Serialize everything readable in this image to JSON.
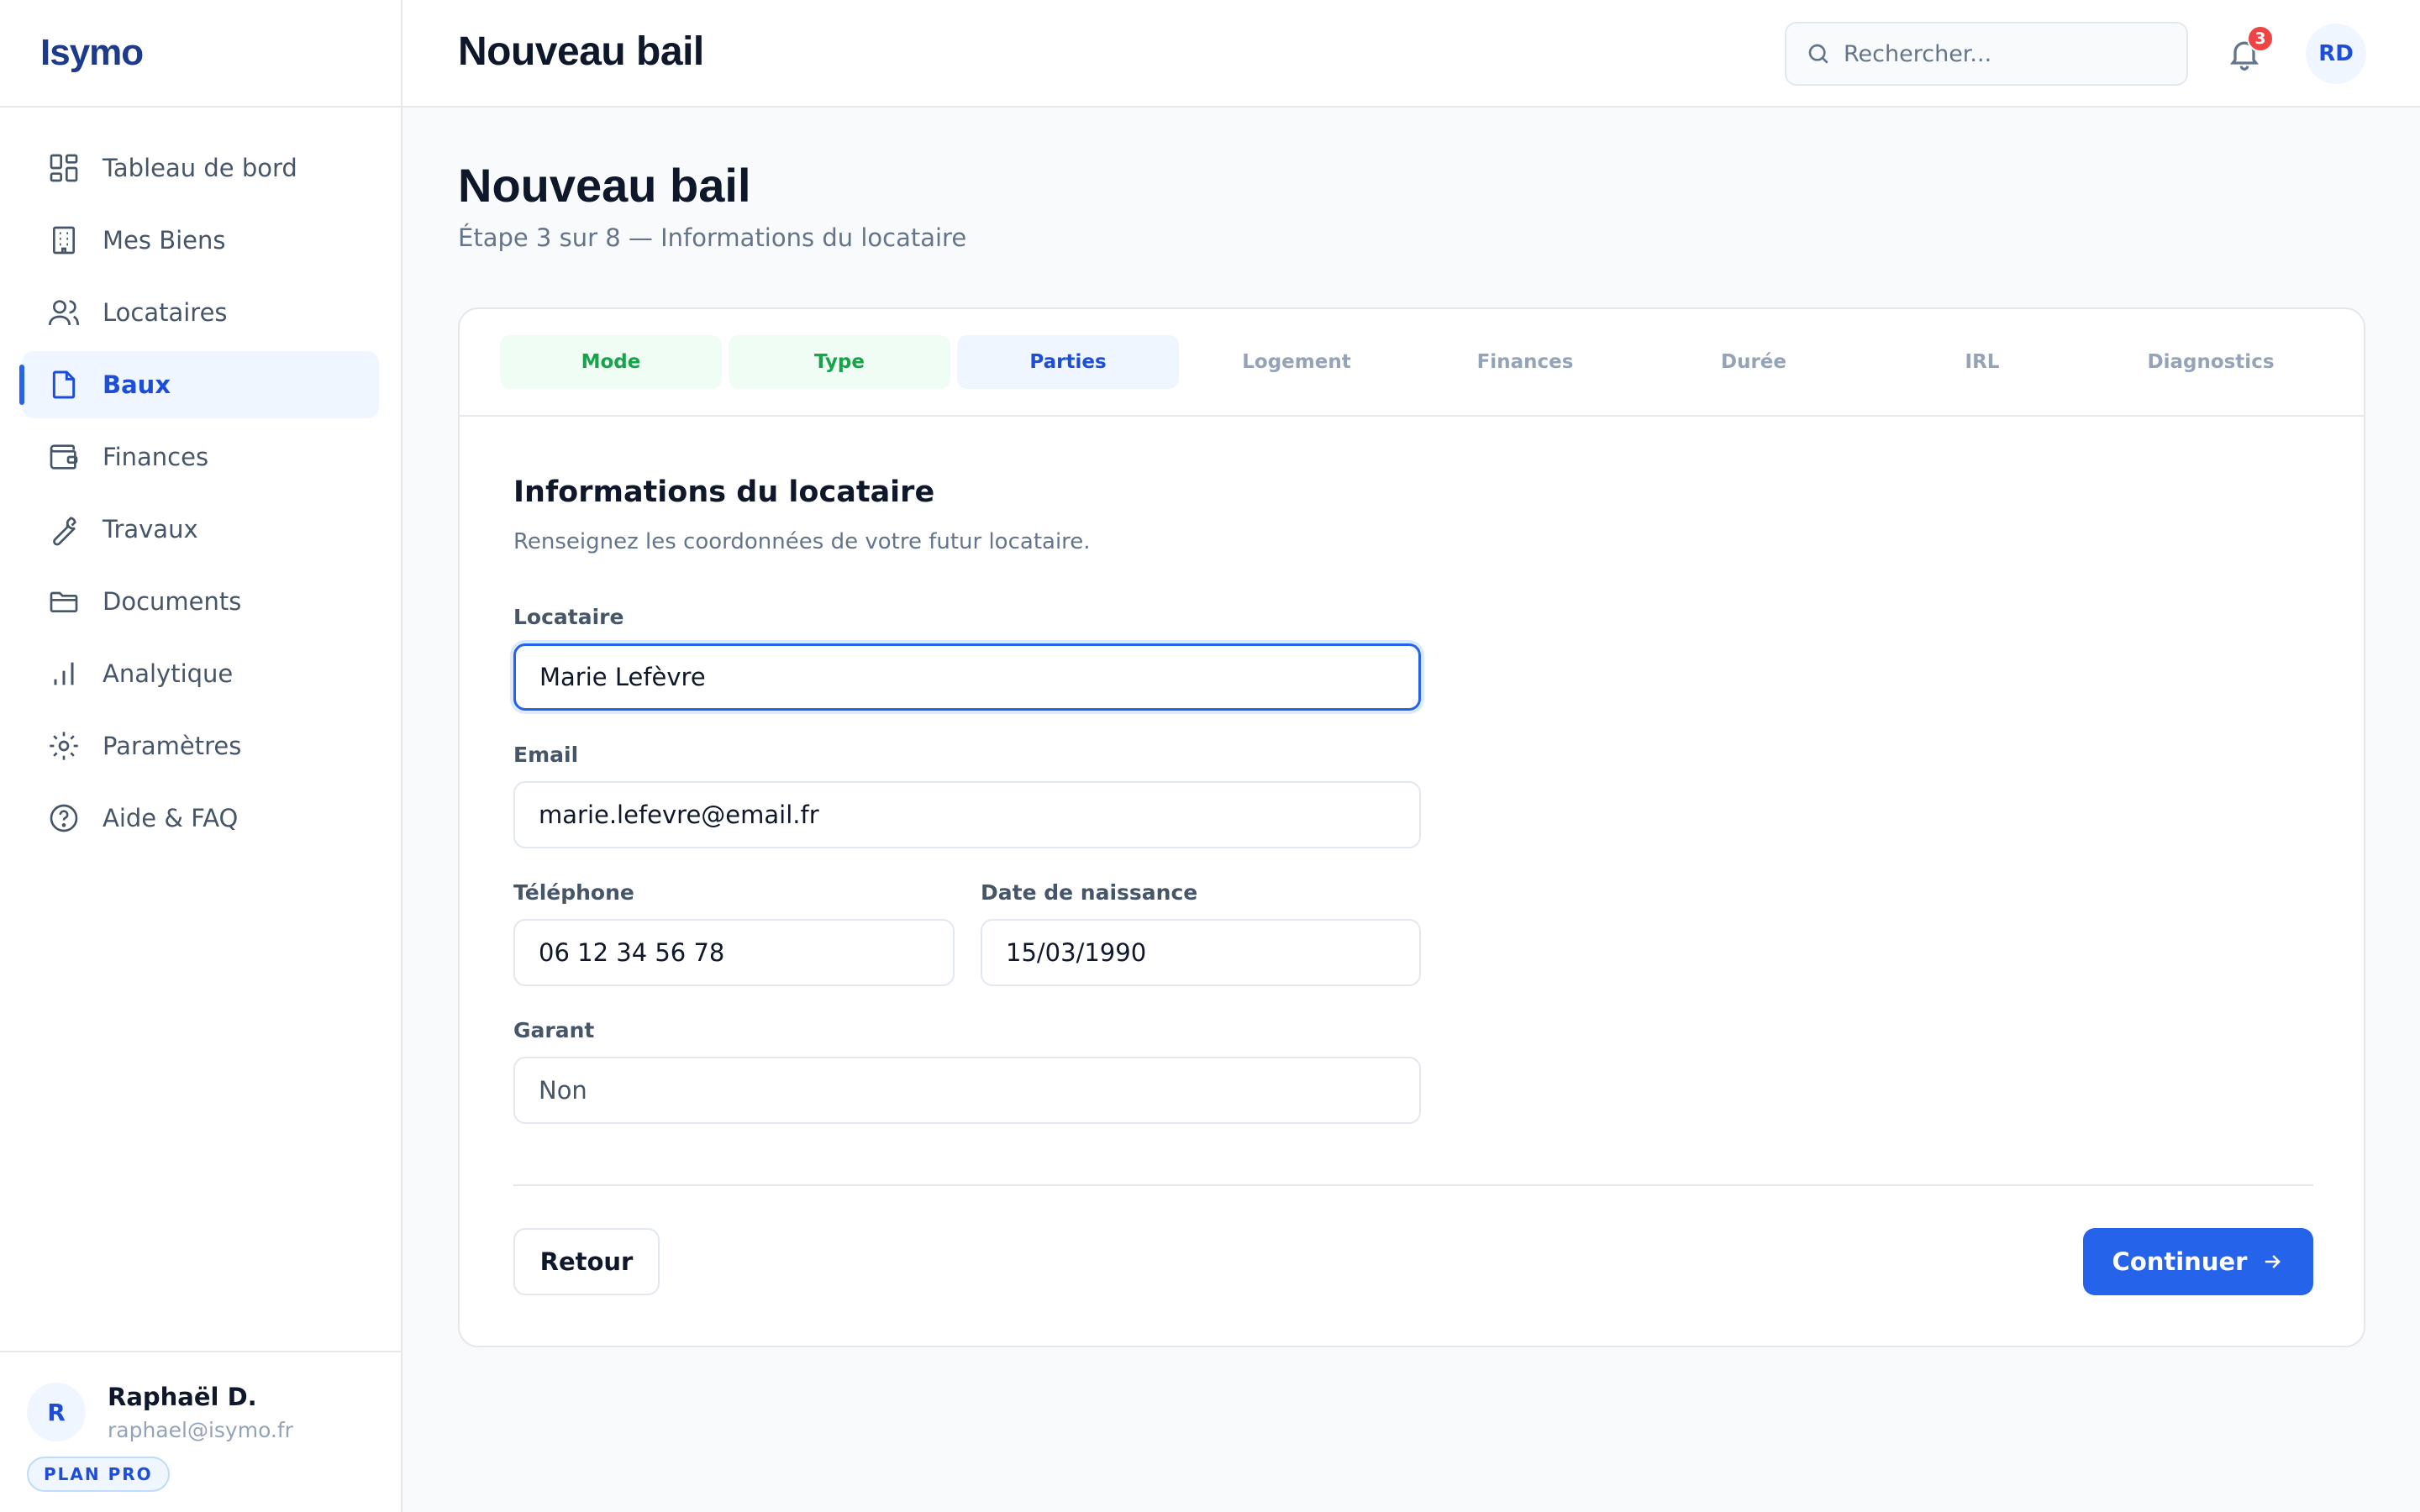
{
  "app": {
    "brand": "Isymo"
  },
  "sidebar": {
    "items": [
      {
        "label": "Tableau de bord",
        "icon": "grid-icon"
      },
      {
        "label": "Mes Biens",
        "icon": "building-icon"
      },
      {
        "label": "Locataires",
        "icon": "users-icon"
      },
      {
        "label": "Baux",
        "icon": "file-icon",
        "active": true
      },
      {
        "label": "Finances",
        "icon": "wallet-icon"
      },
      {
        "label": "Travaux",
        "icon": "wrench-icon"
      },
      {
        "label": "Documents",
        "icon": "folder-icon"
      },
      {
        "label": "Analytique",
        "icon": "bar-chart-icon"
      },
      {
        "label": "Paramètres",
        "icon": "gear-icon"
      },
      {
        "label": "Aide & FAQ",
        "icon": "help-icon"
      }
    ],
    "user": {
      "initial": "R",
      "name": "Raphaël D.",
      "email": "raphael@isymo.fr",
      "plan": "PLAN PRO"
    }
  },
  "header": {
    "title": "Nouveau bail",
    "search_placeholder": "Rechercher...",
    "notifications_count": "3",
    "avatar_initials": "RD"
  },
  "page": {
    "title": "Nouveau bail",
    "subtitle": "Étape 3 sur 8 — Informations du locataire"
  },
  "stepper": {
    "steps": [
      {
        "label": "Mode",
        "state": "done"
      },
      {
        "label": "Type",
        "state": "done"
      },
      {
        "label": "Parties",
        "state": "current"
      },
      {
        "label": "Logement",
        "state": "pending"
      },
      {
        "label": "Finances",
        "state": "pending"
      },
      {
        "label": "Durée",
        "state": "pending"
      },
      {
        "label": "IRL",
        "state": "pending"
      },
      {
        "label": "Diagnostics",
        "state": "pending"
      }
    ]
  },
  "form": {
    "title": "Informations du locataire",
    "description": "Renseignez les coordonnées de votre futur locataire.",
    "tenant": {
      "label": "Locataire",
      "value": "Marie Lefèvre"
    },
    "email": {
      "label": "Email",
      "value": "marie.lefevre@email.fr"
    },
    "phone": {
      "label": "Téléphone",
      "value": "06 12 34 56 78"
    },
    "birthdate": {
      "label": "Date de naissance",
      "value": "15/03/1990"
    },
    "guarantor": {
      "label": "Garant",
      "value": "Non"
    }
  },
  "actions": {
    "back": "Retour",
    "next": "Continuer"
  },
  "colors": {
    "accent": "#2563eb",
    "brand": "#1e3a8a",
    "success": "#16a34a",
    "badge": "#ef4444"
  }
}
